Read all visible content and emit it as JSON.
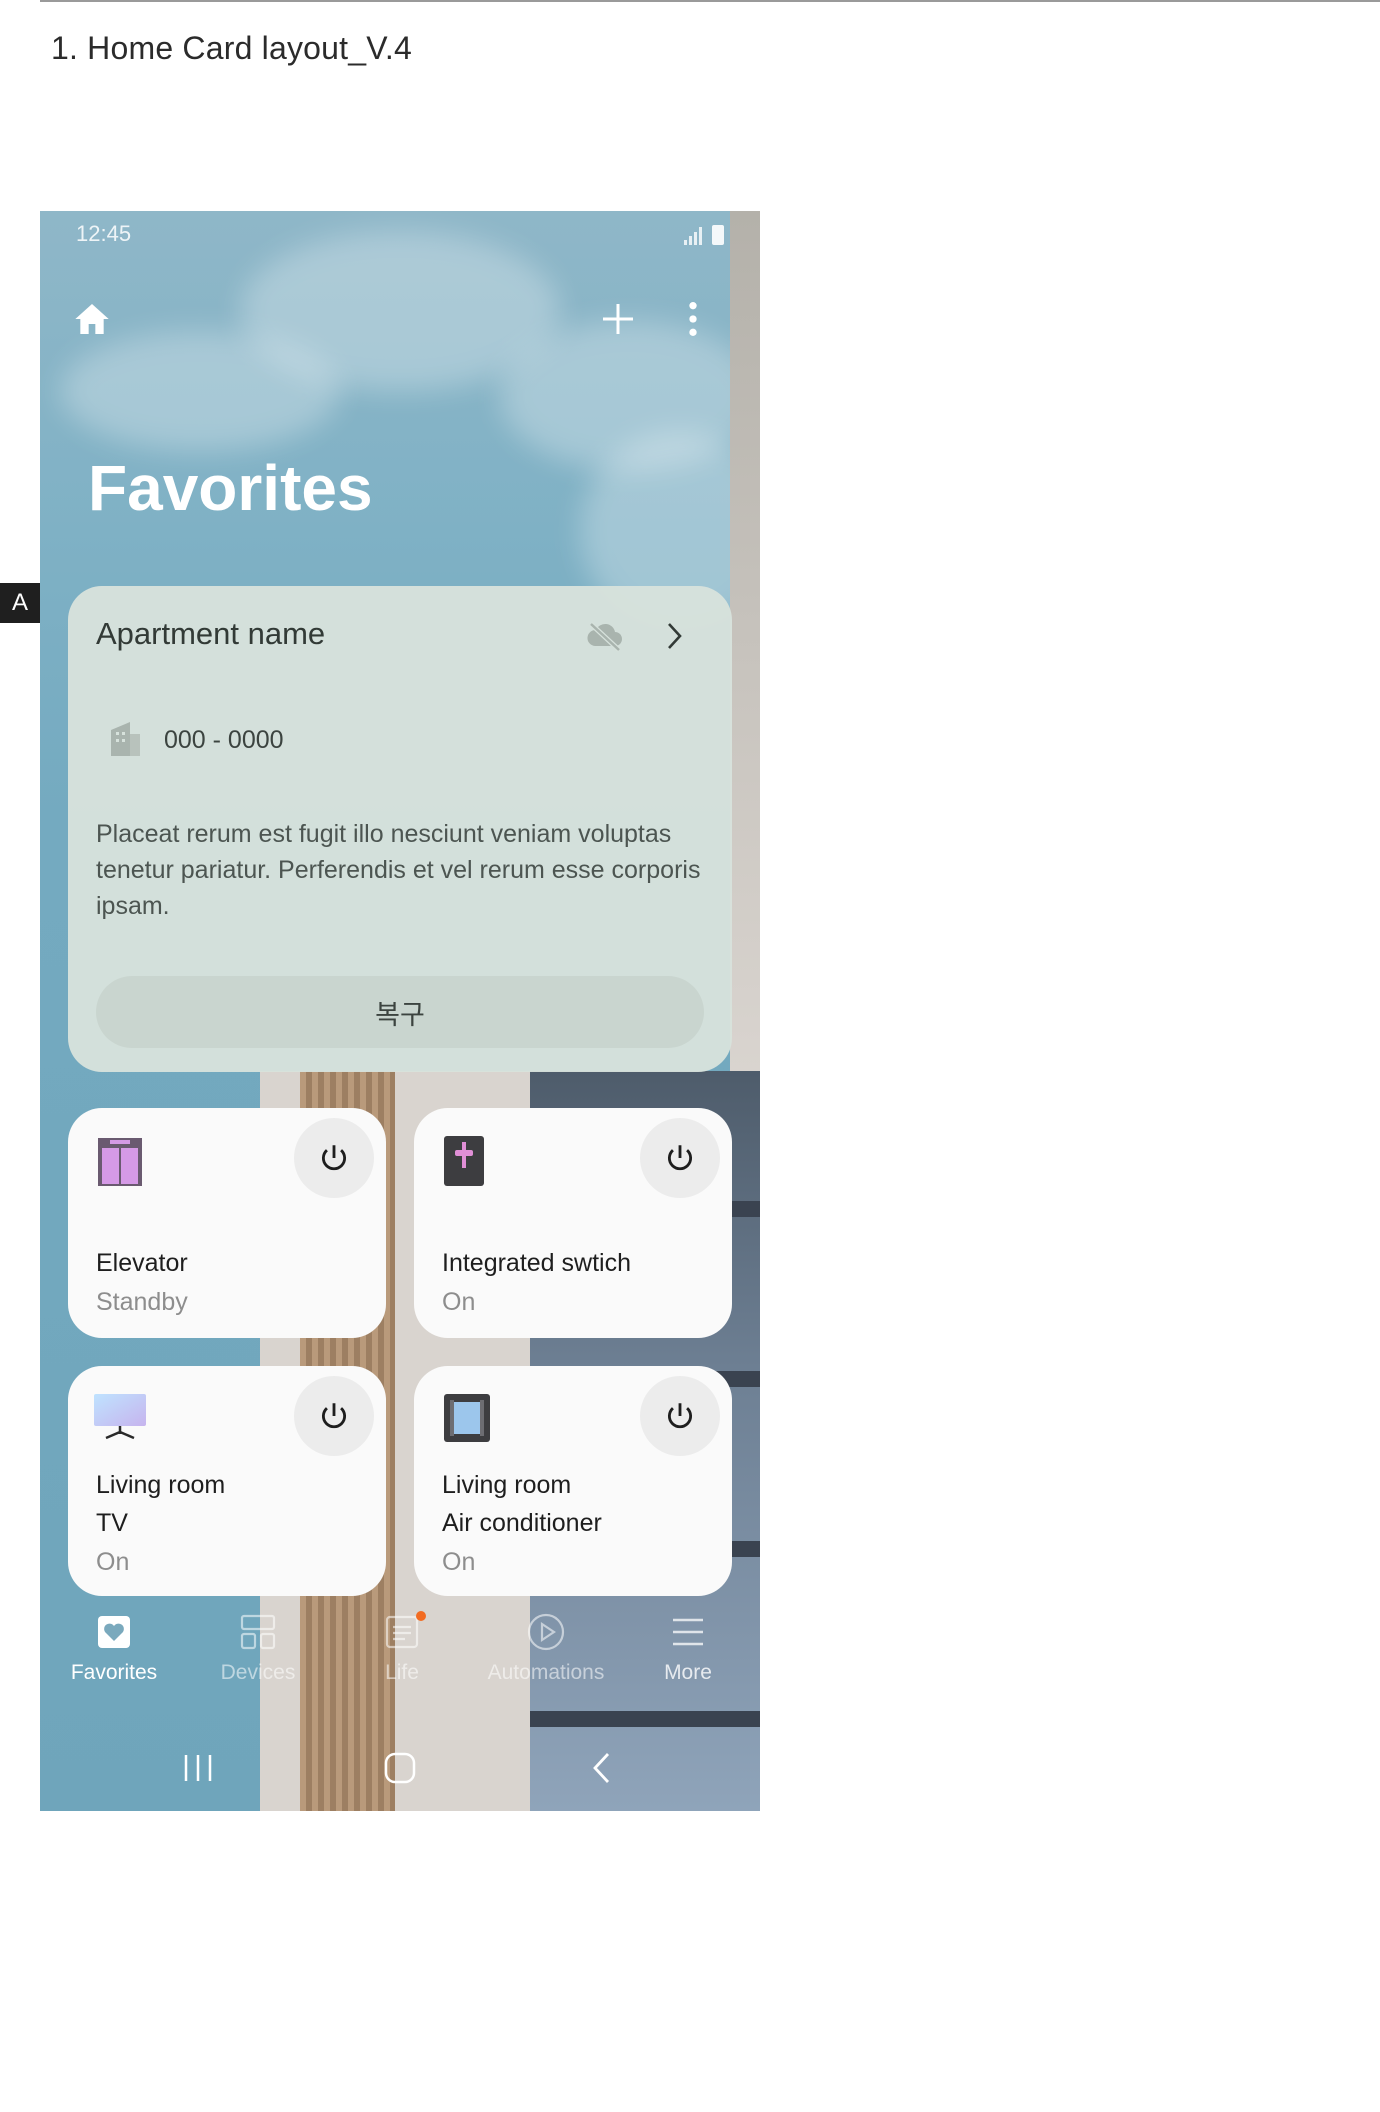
{
  "document": {
    "title": "1. Home Card layout_V.4",
    "side_marker": "A"
  },
  "status_bar": {
    "time": "12:45",
    "icons": [
      "signal-icon",
      "battery-icon"
    ]
  },
  "app_bar": {
    "icons": [
      "home-icon",
      "add-icon",
      "more-options-icon"
    ]
  },
  "page": {
    "title": "Favorites"
  },
  "apartment_card": {
    "name": "Apartment name",
    "icons": [
      "cloud-off-icon",
      "chevron-right-icon",
      "building-icon"
    ],
    "unit_number": "000 - 0000",
    "description": "Placeat rerum est fugit illo nesciunt veniam voluptas tenetur pariatur. Perferendis et vel rerum esse corporis ipsam.",
    "restore_button": "복구"
  },
  "devices": [
    {
      "name": "Elevator",
      "status": "Standby",
      "icon": "elevator-icon"
    },
    {
      "name": "Integrated swtich",
      "status": "On",
      "icon": "switch-icon"
    },
    {
      "name_line1": "Living room",
      "name_line2": "TV",
      "status": "On",
      "icon": "tv-icon"
    },
    {
      "name_line1": "Living room",
      "name_line2": "Air conditioner",
      "status": "On",
      "icon": "air-conditioner-icon"
    }
  ],
  "bottom_nav": {
    "items": [
      {
        "label": "Favorites",
        "icon": "favorites-icon",
        "active": true
      },
      {
        "label": "Devices",
        "icon": "devices-icon",
        "active": false
      },
      {
        "label": "Life",
        "icon": "life-icon",
        "active": false
      },
      {
        "label": "Automations",
        "icon": "automations-icon",
        "active": false
      },
      {
        "label": "More",
        "icon": "menu-icon",
        "active": false
      }
    ]
  },
  "system_nav": {
    "icons": [
      "recent-apps-icon",
      "home-button-icon",
      "back-icon"
    ]
  },
  "colors": {
    "sky": "#7fb1c5",
    "apartment_card": "#d7e2dc",
    "device_card": "#fafafa",
    "elevator_accent": "#d59ae6",
    "switch_accent": "#e08fd6",
    "notification_dot": "#f26b21"
  }
}
